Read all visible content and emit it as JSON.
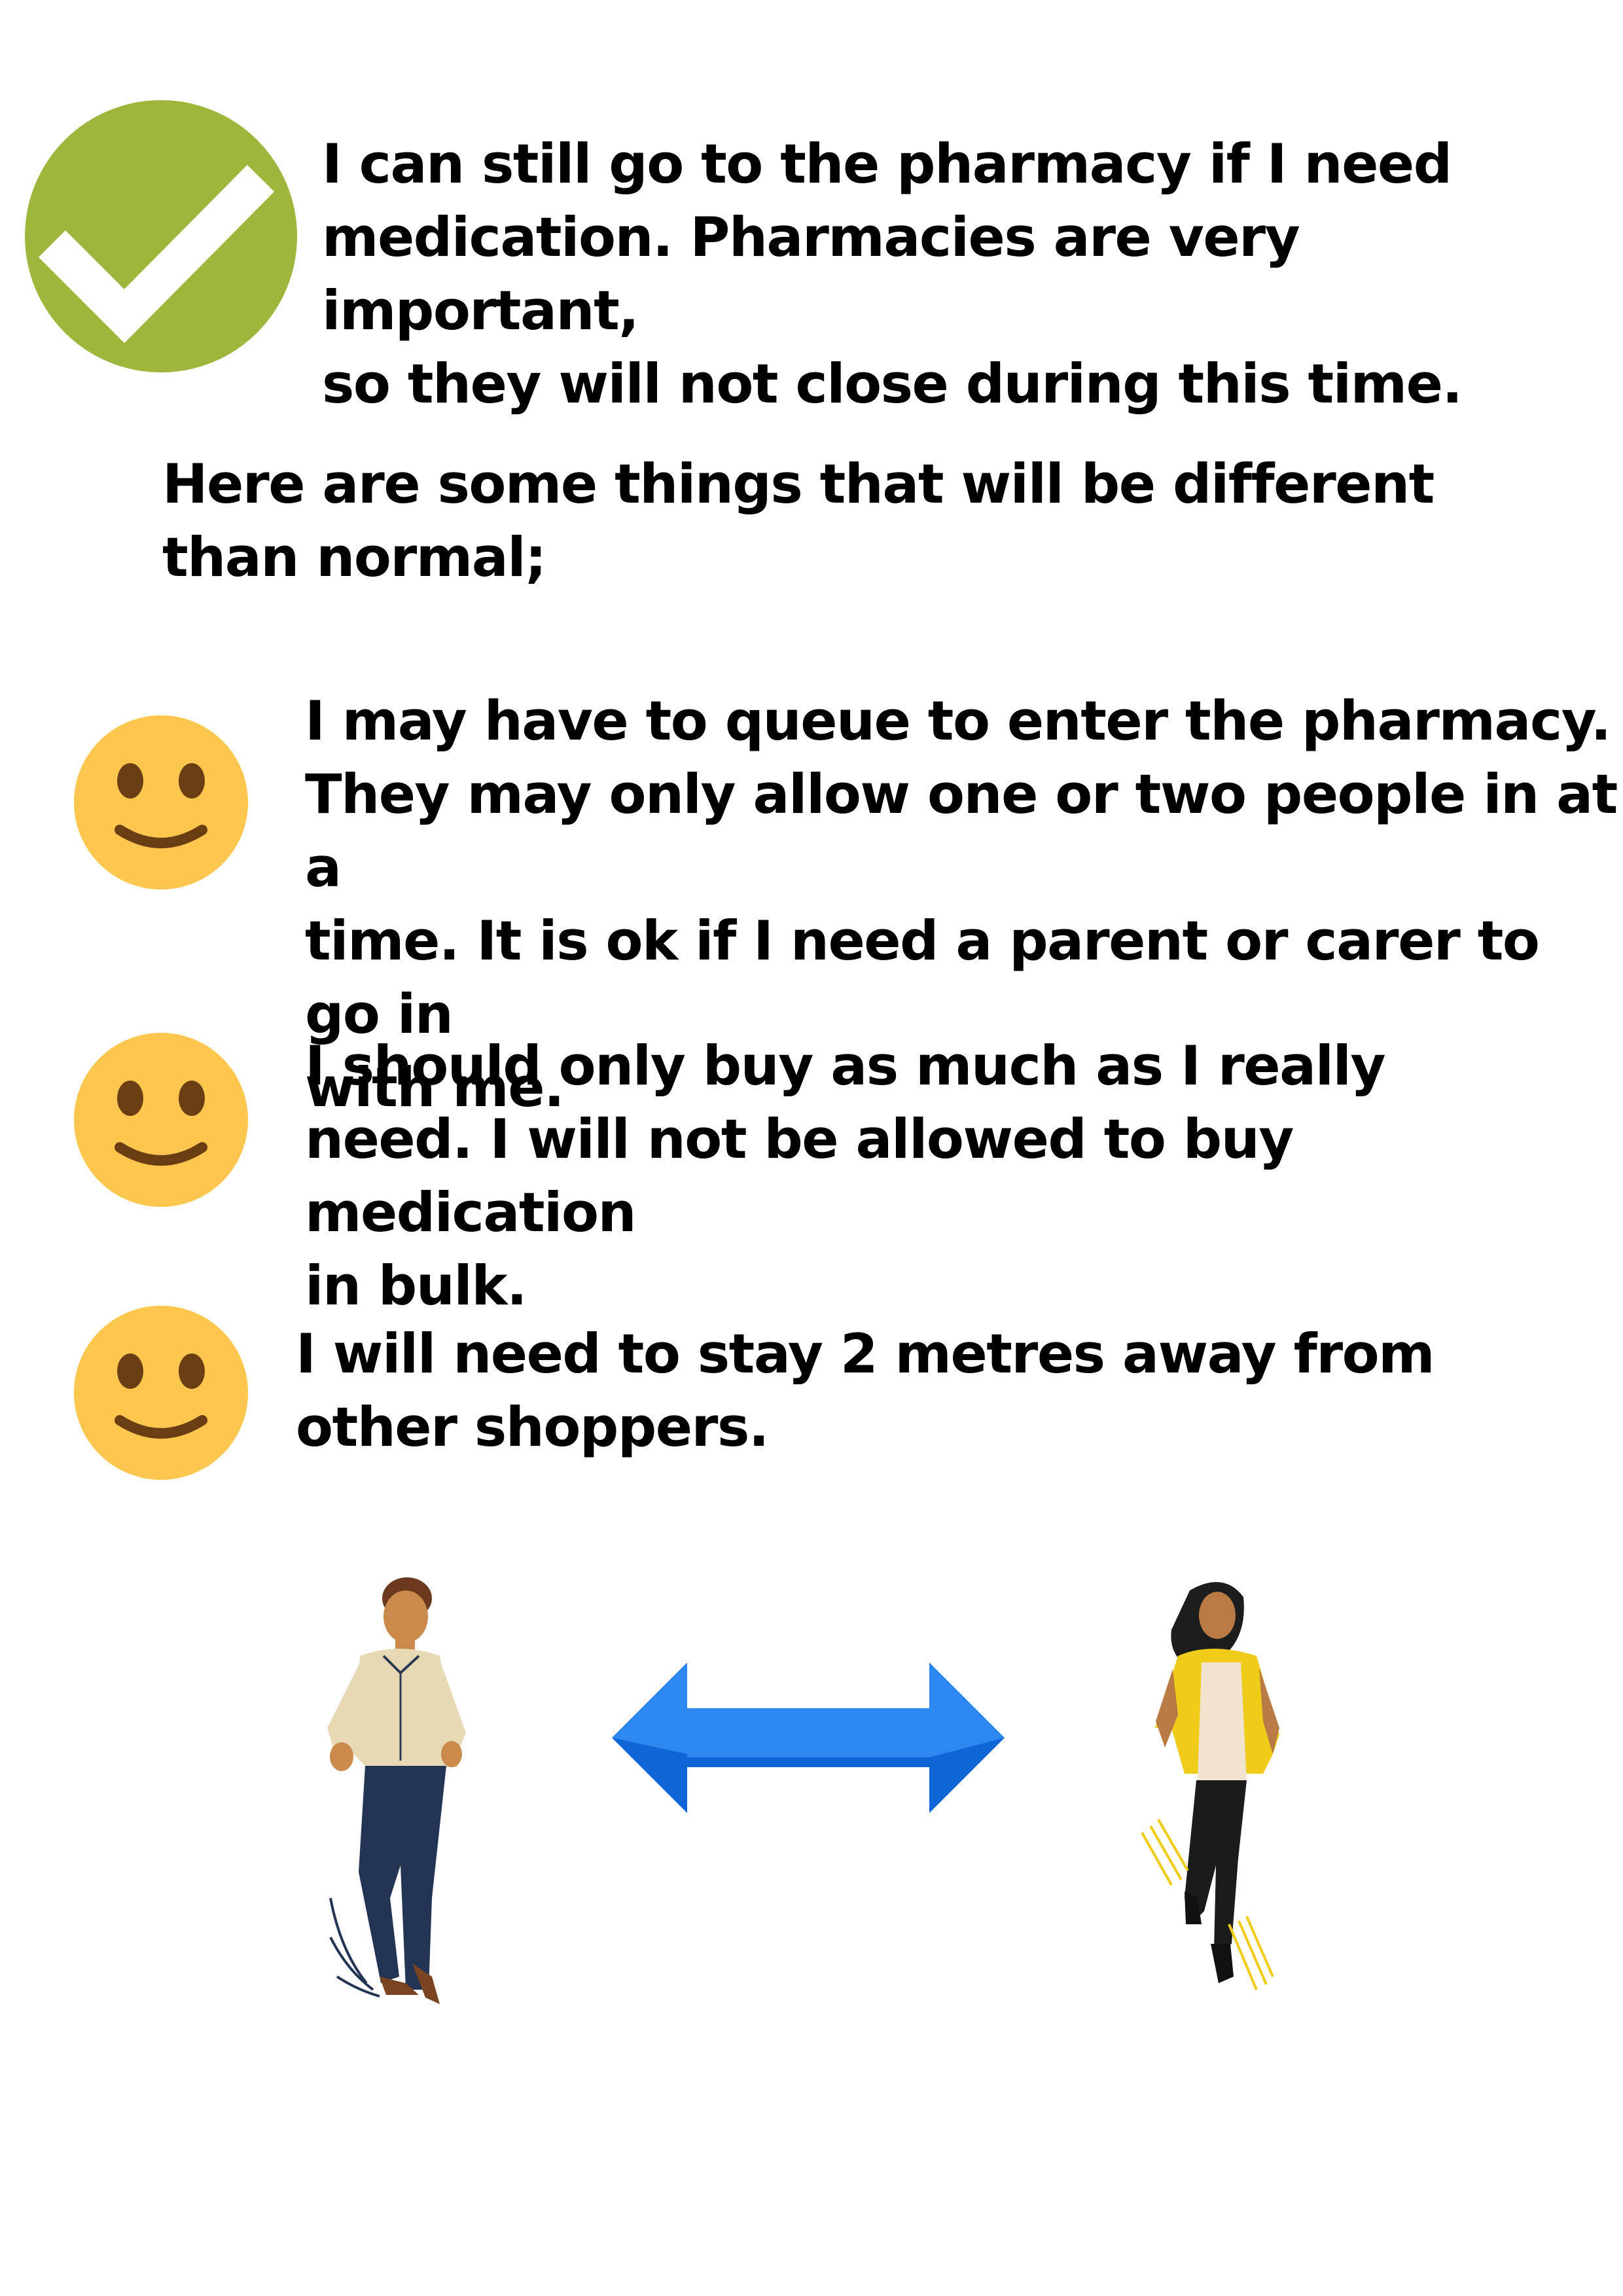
{
  "intro": {
    "icon": "checkmark-circle-icon",
    "icon_color": "#9cb73c",
    "text": "I can still go to the pharmacy if I need\nmedication. Pharmacies are very important,\nso they will not close during this time."
  },
  "section_heading": "Here are some things that will be different\nthan normal;",
  "items": [
    {
      "icon": "smiley-face-icon",
      "text": "I may have to queue to enter the pharmacy.\nThey may only allow one or two people in at a\ntime. It is ok if I need a parent or carer to go in\nwith me."
    },
    {
      "icon": "smiley-face-icon",
      "text": "I should only buy as much as I really\nneed. I will not be allowed to buy medication\nin bulk."
    },
    {
      "icon": "smiley-face-icon",
      "text": "I will need to stay 2 metres away from\nother shoppers."
    }
  ],
  "colors": {
    "smiley": "#fdc64e",
    "smiley_features": "#6b3d12",
    "arrow": "#2d87f0",
    "arrow_dark": "#0b5fd0"
  },
  "illustration": {
    "left_figure": "man-standing-icon",
    "arrow": "double-headed-arrow-icon",
    "right_figure": "woman-walking-icon"
  }
}
